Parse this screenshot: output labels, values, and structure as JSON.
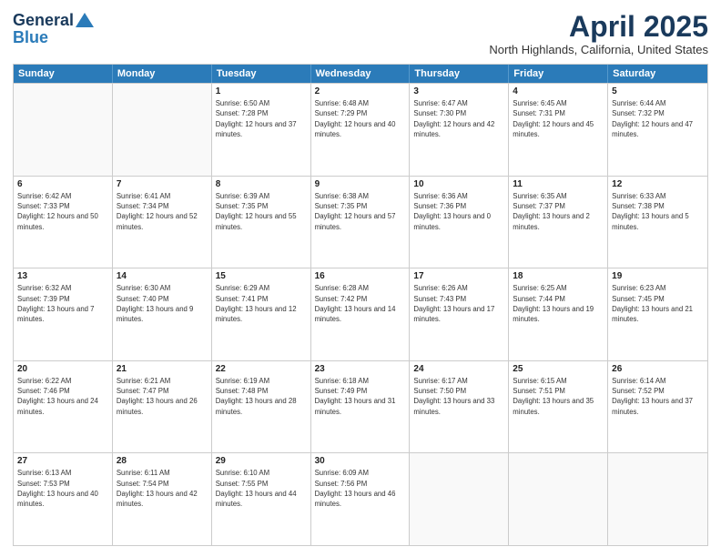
{
  "header": {
    "logo_general": "General",
    "logo_blue": "Blue",
    "month_title": "April 2025",
    "location": "North Highlands, California, United States"
  },
  "days_of_week": [
    "Sunday",
    "Monday",
    "Tuesday",
    "Wednesday",
    "Thursday",
    "Friday",
    "Saturday"
  ],
  "weeks": [
    [
      {
        "day": "",
        "sunrise": "",
        "sunset": "",
        "daylight": ""
      },
      {
        "day": "",
        "sunrise": "",
        "sunset": "",
        "daylight": ""
      },
      {
        "day": "1",
        "sunrise": "Sunrise: 6:50 AM",
        "sunset": "Sunset: 7:28 PM",
        "daylight": "Daylight: 12 hours and 37 minutes."
      },
      {
        "day": "2",
        "sunrise": "Sunrise: 6:48 AM",
        "sunset": "Sunset: 7:29 PM",
        "daylight": "Daylight: 12 hours and 40 minutes."
      },
      {
        "day": "3",
        "sunrise": "Sunrise: 6:47 AM",
        "sunset": "Sunset: 7:30 PM",
        "daylight": "Daylight: 12 hours and 42 minutes."
      },
      {
        "day": "4",
        "sunrise": "Sunrise: 6:45 AM",
        "sunset": "Sunset: 7:31 PM",
        "daylight": "Daylight: 12 hours and 45 minutes."
      },
      {
        "day": "5",
        "sunrise": "Sunrise: 6:44 AM",
        "sunset": "Sunset: 7:32 PM",
        "daylight": "Daylight: 12 hours and 47 minutes."
      }
    ],
    [
      {
        "day": "6",
        "sunrise": "Sunrise: 6:42 AM",
        "sunset": "Sunset: 7:33 PM",
        "daylight": "Daylight: 12 hours and 50 minutes."
      },
      {
        "day": "7",
        "sunrise": "Sunrise: 6:41 AM",
        "sunset": "Sunset: 7:34 PM",
        "daylight": "Daylight: 12 hours and 52 minutes."
      },
      {
        "day": "8",
        "sunrise": "Sunrise: 6:39 AM",
        "sunset": "Sunset: 7:35 PM",
        "daylight": "Daylight: 12 hours and 55 minutes."
      },
      {
        "day": "9",
        "sunrise": "Sunrise: 6:38 AM",
        "sunset": "Sunset: 7:35 PM",
        "daylight": "Daylight: 12 hours and 57 minutes."
      },
      {
        "day": "10",
        "sunrise": "Sunrise: 6:36 AM",
        "sunset": "Sunset: 7:36 PM",
        "daylight": "Daylight: 13 hours and 0 minutes."
      },
      {
        "day": "11",
        "sunrise": "Sunrise: 6:35 AM",
        "sunset": "Sunset: 7:37 PM",
        "daylight": "Daylight: 13 hours and 2 minutes."
      },
      {
        "day": "12",
        "sunrise": "Sunrise: 6:33 AM",
        "sunset": "Sunset: 7:38 PM",
        "daylight": "Daylight: 13 hours and 5 minutes."
      }
    ],
    [
      {
        "day": "13",
        "sunrise": "Sunrise: 6:32 AM",
        "sunset": "Sunset: 7:39 PM",
        "daylight": "Daylight: 13 hours and 7 minutes."
      },
      {
        "day": "14",
        "sunrise": "Sunrise: 6:30 AM",
        "sunset": "Sunset: 7:40 PM",
        "daylight": "Daylight: 13 hours and 9 minutes."
      },
      {
        "day": "15",
        "sunrise": "Sunrise: 6:29 AM",
        "sunset": "Sunset: 7:41 PM",
        "daylight": "Daylight: 13 hours and 12 minutes."
      },
      {
        "day": "16",
        "sunrise": "Sunrise: 6:28 AM",
        "sunset": "Sunset: 7:42 PM",
        "daylight": "Daylight: 13 hours and 14 minutes."
      },
      {
        "day": "17",
        "sunrise": "Sunrise: 6:26 AM",
        "sunset": "Sunset: 7:43 PM",
        "daylight": "Daylight: 13 hours and 17 minutes."
      },
      {
        "day": "18",
        "sunrise": "Sunrise: 6:25 AM",
        "sunset": "Sunset: 7:44 PM",
        "daylight": "Daylight: 13 hours and 19 minutes."
      },
      {
        "day": "19",
        "sunrise": "Sunrise: 6:23 AM",
        "sunset": "Sunset: 7:45 PM",
        "daylight": "Daylight: 13 hours and 21 minutes."
      }
    ],
    [
      {
        "day": "20",
        "sunrise": "Sunrise: 6:22 AM",
        "sunset": "Sunset: 7:46 PM",
        "daylight": "Daylight: 13 hours and 24 minutes."
      },
      {
        "day": "21",
        "sunrise": "Sunrise: 6:21 AM",
        "sunset": "Sunset: 7:47 PM",
        "daylight": "Daylight: 13 hours and 26 minutes."
      },
      {
        "day": "22",
        "sunrise": "Sunrise: 6:19 AM",
        "sunset": "Sunset: 7:48 PM",
        "daylight": "Daylight: 13 hours and 28 minutes."
      },
      {
        "day": "23",
        "sunrise": "Sunrise: 6:18 AM",
        "sunset": "Sunset: 7:49 PM",
        "daylight": "Daylight: 13 hours and 31 minutes."
      },
      {
        "day": "24",
        "sunrise": "Sunrise: 6:17 AM",
        "sunset": "Sunset: 7:50 PM",
        "daylight": "Daylight: 13 hours and 33 minutes."
      },
      {
        "day": "25",
        "sunrise": "Sunrise: 6:15 AM",
        "sunset": "Sunset: 7:51 PM",
        "daylight": "Daylight: 13 hours and 35 minutes."
      },
      {
        "day": "26",
        "sunrise": "Sunrise: 6:14 AM",
        "sunset": "Sunset: 7:52 PM",
        "daylight": "Daylight: 13 hours and 37 minutes."
      }
    ],
    [
      {
        "day": "27",
        "sunrise": "Sunrise: 6:13 AM",
        "sunset": "Sunset: 7:53 PM",
        "daylight": "Daylight: 13 hours and 40 minutes."
      },
      {
        "day": "28",
        "sunrise": "Sunrise: 6:11 AM",
        "sunset": "Sunset: 7:54 PM",
        "daylight": "Daylight: 13 hours and 42 minutes."
      },
      {
        "day": "29",
        "sunrise": "Sunrise: 6:10 AM",
        "sunset": "Sunset: 7:55 PM",
        "daylight": "Daylight: 13 hours and 44 minutes."
      },
      {
        "day": "30",
        "sunrise": "Sunrise: 6:09 AM",
        "sunset": "Sunset: 7:56 PM",
        "daylight": "Daylight: 13 hours and 46 minutes."
      },
      {
        "day": "",
        "sunrise": "",
        "sunset": "",
        "daylight": ""
      },
      {
        "day": "",
        "sunrise": "",
        "sunset": "",
        "daylight": ""
      },
      {
        "day": "",
        "sunrise": "",
        "sunset": "",
        "daylight": ""
      }
    ]
  ]
}
